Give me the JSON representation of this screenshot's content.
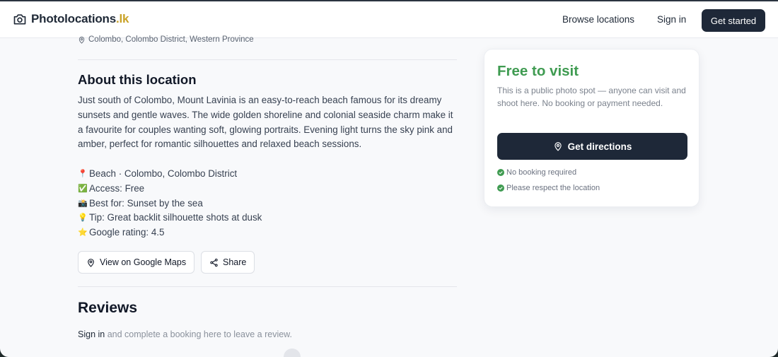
{
  "header": {
    "logo_name": "Photolocations",
    "logo_tld": ".lk",
    "nav": {
      "browse": "Browse locations",
      "signin": "Sign in",
      "get_started": "Get started"
    }
  },
  "location": {
    "address": "Colombo, Colombo District, Western Province",
    "about_heading": "About this location",
    "description": "Just south of Colombo, Mount Lavinia is an easy-to-reach beach famous for its dreamy sunsets and gentle waves. The wide golden shoreline and colonial seaside charm make it a favourite for couples wanting soft, glowing portraits. Evening light turns the sky pink and amber, perfect for romantic silhouettes and relaxed beach sessions.",
    "facts": [
      {
        "icon": "📍",
        "text": "Beach · Colombo, Colombo District"
      },
      {
        "icon": "✅",
        "text": "Access: Free"
      },
      {
        "icon": "📸",
        "text": "Best for: Sunset by the sea"
      },
      {
        "icon": "💡",
        "text": "Tip: Great backlit silhouette shots at dusk"
      },
      {
        "icon": "⭐",
        "text": "Google rating: 4.5"
      }
    ],
    "buttons": {
      "maps": "View on Google Maps",
      "share": "Share"
    }
  },
  "reviews": {
    "heading": "Reviews",
    "signin_link": "Sign in",
    "note": " and complete a booking here to leave a review."
  },
  "visit_card": {
    "title": "Free to visit",
    "note": "This is a public photo spot — anyone can visit and shoot here. No booking or payment needed.",
    "directions_button": "Get directions",
    "checks": [
      "No booking required",
      "Please respect the location"
    ]
  },
  "colors": {
    "primary_dark": "#1e2838",
    "accent_green": "#3f9b51",
    "logo_gold": "#c9a227"
  }
}
